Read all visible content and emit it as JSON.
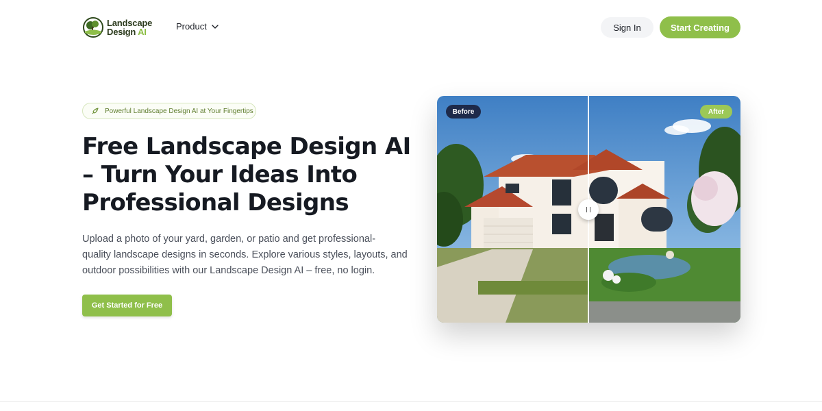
{
  "header": {
    "logo": {
      "line1": "Landscape",
      "line2_main": "Design",
      "line2_accent": "AI",
      "icon": "tree-logo-icon"
    },
    "nav": {
      "product_label": "Product",
      "product_icon": "chevron-down-icon"
    },
    "sign_in_label": "Sign In",
    "start_creating_label": "Start Creating"
  },
  "hero": {
    "tag": {
      "text": "Powerful Landscape Design AI at Your Fingertips",
      "icon": "rocket-icon"
    },
    "title_lines": [
      "Free Landscape Design AI",
      "– Turn Your Ideas Into",
      "Professional Designs"
    ],
    "description_lines": [
      "Upload a photo of your yard, garden, or patio and get professional-",
      "quality landscape designs in seconds. Explore various styles, layouts, and",
      "outdoor possibilities with our Landscape Design AI – free, no login."
    ],
    "cta_label": "Get Started for Free"
  },
  "comparison": {
    "before_label": "Before",
    "after_label": "After",
    "handle_icon": "drag-handle-icon"
  },
  "colors": {
    "accent": "#8fbf4a",
    "before_badge": "#1e2a4a",
    "after_badge": "#9cc857",
    "title": "#161a22"
  }
}
